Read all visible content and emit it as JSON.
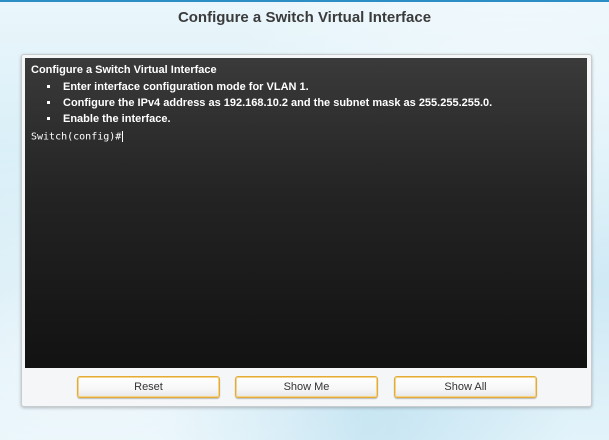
{
  "page": {
    "title": "Configure a Switch Virtual Interface"
  },
  "terminal": {
    "heading": "Configure a Switch Virtual Interface",
    "tasks": [
      "Enter interface configuration mode for VLAN 1.",
      "Configure the IPv4 address as 192.168.10.2 and the subnet mask as 255.255.255.0.",
      "Enable the interface."
    ],
    "prompt": "Switch(config)#"
  },
  "buttons": {
    "reset": "Reset",
    "show_me": "Show Me",
    "show_all": "Show All"
  },
  "colors": {
    "accent_border": "#e3ac36",
    "terminal_bg": "#1a1a1a",
    "title_text": "#3b3b3b",
    "top_rule": "#2b8fc6"
  }
}
